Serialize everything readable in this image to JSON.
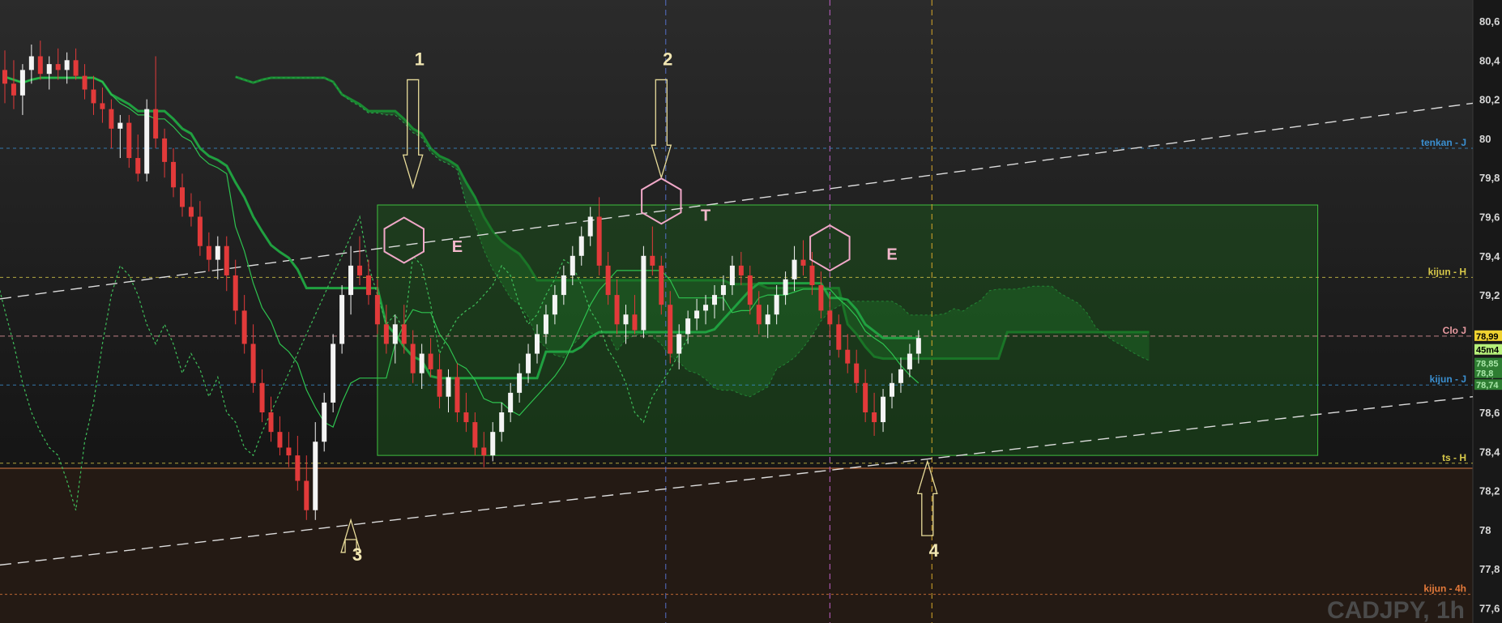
{
  "chart_data": {
    "type": "candlestick",
    "symbol_label": "CADJPY, 1h",
    "ylim": [
      77.55,
      80.7
    ],
    "y_ticks": [
      "80,6",
      "80,4",
      "80,2",
      "80",
      "79,8",
      "79,6",
      "79,4",
      "79,2",
      "79",
      "78,8",
      "78,6",
      "78,4",
      "78,2",
      "78",
      "77,8",
      "77,6"
    ],
    "y_tick_values": [
      80.6,
      80.4,
      80.2,
      80.0,
      79.8,
      79.6,
      79.4,
      79.2,
      79.0,
      78.8,
      78.6,
      78.4,
      78.2,
      78.0,
      77.8,
      77.6
    ],
    "levels": [
      {
        "label": "tenkan - J",
        "value": 79.95,
        "color": "#3a8fd0",
        "dash": "4,4"
      },
      {
        "label": "kijun - H",
        "value": 79.29,
        "color": "#d8c94a",
        "dash": "4,4"
      },
      {
        "label": "Clo J",
        "value": 78.99,
        "color": "#e89aa0",
        "dash": "6,4"
      },
      {
        "label": "kijun - J",
        "value": 78.74,
        "color": "#3a8fd0",
        "dash": "4,4"
      },
      {
        "label": "ts - H",
        "value": 78.34,
        "color": "#d8c94a",
        "dash": "4,4"
      },
      {
        "label": "kijun - 4h",
        "value": 77.67,
        "color": "#e57a3a",
        "dash": "3,3"
      }
    ],
    "price_badges": [
      {
        "label": "78,99",
        "value": 78.99,
        "bg": "#f0d230",
        "fg": "#000000"
      },
      {
        "label": "45m4",
        "value": 78.92,
        "bg": "#b6f07a",
        "fg": "#000000"
      },
      {
        "label": "78,85",
        "value": 78.85,
        "bg": "#2e7d32",
        "fg": "#a8e6a8"
      },
      {
        "label": "78,8",
        "value": 78.8,
        "bg": "#2e7d32",
        "fg": "#a8e6a8"
      },
      {
        "label": "78,74",
        "value": 78.74,
        "bg": "#2e7d32",
        "fg": "#a8e6a8"
      }
    ],
    "annotations": {
      "arrows": [
        {
          "label": "1",
          "bar": 46,
          "dir": "down",
          "from": 80.3,
          "to": 79.75
        },
        {
          "label": "2",
          "bar": 74,
          "dir": "down",
          "from": 80.3,
          "to": 79.8
        },
        {
          "label": "3",
          "bar": 39,
          "dir": "up",
          "from": 77.95,
          "to": 78.05
        },
        {
          "label": "4",
          "bar": 104,
          "dir": "up",
          "from": 77.97,
          "to": 78.35
        }
      ],
      "pattern_letters": [
        {
          "label": "E",
          "bar": 51,
          "value": 79.42
        },
        {
          "label": "T",
          "bar": 79,
          "value": 79.58
        },
        {
          "label": "E",
          "bar": 100,
          "value": 79.38
        }
      ],
      "hexagons": [
        {
          "bar": 45,
          "value": 79.48
        },
        {
          "bar": 74,
          "value": 79.68
        },
        {
          "bar": 93,
          "value": 79.44
        }
      ],
      "range_box": {
        "from_bar": 42,
        "to_bar": 148,
        "high": 79.66,
        "low": 78.38
      }
    },
    "candles": [
      [
        80.35,
        80.45,
        80.18,
        80.28
      ],
      [
        80.28,
        80.4,
        80.15,
        80.22
      ],
      [
        80.22,
        80.38,
        80.12,
        80.35
      ],
      [
        80.35,
        80.48,
        80.28,
        80.42
      ],
      [
        80.42,
        80.5,
        80.3,
        80.33
      ],
      [
        80.33,
        80.42,
        80.25,
        80.38
      ],
      [
        80.38,
        80.46,
        80.3,
        80.35
      ],
      [
        80.35,
        80.44,
        80.28,
        80.4
      ],
      [
        80.4,
        80.46,
        80.3,
        80.32
      ],
      [
        80.32,
        80.38,
        80.2,
        80.25
      ],
      [
        80.25,
        80.32,
        80.12,
        80.18
      ],
      [
        80.18,
        80.26,
        80.08,
        80.15
      ],
      [
        80.15,
        80.2,
        79.95,
        80.05
      ],
      [
        80.05,
        80.12,
        79.9,
        80.08
      ],
      [
        80.08,
        80.12,
        79.85,
        79.9
      ],
      [
        79.9,
        80.02,
        79.78,
        79.82
      ],
      [
        79.82,
        80.2,
        79.78,
        80.15
      ],
      [
        80.15,
        80.42,
        79.95,
        80.0
      ],
      [
        80.0,
        80.05,
        79.8,
        79.88
      ],
      [
        79.88,
        79.95,
        79.7,
        79.75
      ],
      [
        79.75,
        79.82,
        79.6,
        79.65
      ],
      [
        79.65,
        79.72,
        79.55,
        79.6
      ],
      [
        79.6,
        79.68,
        79.4,
        79.45
      ],
      [
        79.45,
        79.52,
        79.32,
        79.38
      ],
      [
        79.38,
        79.5,
        79.28,
        79.45
      ],
      [
        79.45,
        79.5,
        79.22,
        79.3
      ],
      [
        79.3,
        79.38,
        79.05,
        79.12
      ],
      [
        79.12,
        79.2,
        78.9,
        78.95
      ],
      [
        78.95,
        79.05,
        78.7,
        78.75
      ],
      [
        78.75,
        78.82,
        78.55,
        78.6
      ],
      [
        78.6,
        78.68,
        78.45,
        78.5
      ],
      [
        78.5,
        78.58,
        78.38,
        78.42
      ],
      [
        78.42,
        78.5,
        78.32,
        78.38
      ],
      [
        78.38,
        78.48,
        78.2,
        78.25
      ],
      [
        78.25,
        78.38,
        78.05,
        78.1
      ],
      [
        78.1,
        78.55,
        78.05,
        78.45
      ],
      [
        78.45,
        78.7,
        78.4,
        78.65
      ],
      [
        78.65,
        79.0,
        78.6,
        78.95
      ],
      [
        78.95,
        79.25,
        78.9,
        79.2
      ],
      [
        79.2,
        79.45,
        79.1,
        79.35
      ],
      [
        79.35,
        79.5,
        79.25,
        79.3
      ],
      [
        79.3,
        79.38,
        79.15,
        79.2
      ],
      [
        79.2,
        79.28,
        79.0,
        79.05
      ],
      [
        79.05,
        79.15,
        78.9,
        78.95
      ],
      [
        78.95,
        79.1,
        78.85,
        79.05
      ],
      [
        79.05,
        79.15,
        78.9,
        78.95
      ],
      [
        78.95,
        79.02,
        78.75,
        78.8
      ],
      [
        78.8,
        78.95,
        78.72,
        78.9
      ],
      [
        78.9,
        78.98,
        78.78,
        78.82
      ],
      [
        78.82,
        78.9,
        78.62,
        78.68
      ],
      [
        78.68,
        78.82,
        78.6,
        78.78
      ],
      [
        78.78,
        78.85,
        78.55,
        78.6
      ],
      [
        78.6,
        78.7,
        78.5,
        78.55
      ],
      [
        78.55,
        78.6,
        78.38,
        78.42
      ],
      [
        78.42,
        78.5,
        78.32,
        78.38
      ],
      [
        78.38,
        78.55,
        78.35,
        78.5
      ],
      [
        78.5,
        78.65,
        78.45,
        78.6
      ],
      [
        78.6,
        78.75,
        78.55,
        78.7
      ],
      [
        78.7,
        78.85,
        78.65,
        78.8
      ],
      [
        78.8,
        78.95,
        78.75,
        78.9
      ],
      [
        78.9,
        79.05,
        78.85,
        79.0
      ],
      [
        79.0,
        79.15,
        78.95,
        79.1
      ],
      [
        79.1,
        79.25,
        79.05,
        79.2
      ],
      [
        79.2,
        79.35,
        79.15,
        79.3
      ],
      [
        79.3,
        79.45,
        79.25,
        79.4
      ],
      [
        79.4,
        79.55,
        79.35,
        79.5
      ],
      [
        79.5,
        79.65,
        79.45,
        79.6
      ],
      [
        79.6,
        79.7,
        79.3,
        79.35
      ],
      [
        79.35,
        79.42,
        79.15,
        79.2
      ],
      [
        79.2,
        79.28,
        79.0,
        79.05
      ],
      [
        79.05,
        79.15,
        78.95,
        79.1
      ],
      [
        79.1,
        79.2,
        79.0,
        79.02
      ],
      [
        79.02,
        79.45,
        78.98,
        79.4
      ],
      [
        79.4,
        79.55,
        79.3,
        79.35
      ],
      [
        79.35,
        79.4,
        79.1,
        79.15
      ],
      [
        79.15,
        79.22,
        78.85,
        78.9
      ],
      [
        78.9,
        79.05,
        78.82,
        79.0
      ],
      [
        79.0,
        79.12,
        78.95,
        79.08
      ],
      [
        79.08,
        79.18,
        79.02,
        79.12
      ],
      [
        79.12,
        79.2,
        79.05,
        79.15
      ],
      [
        79.15,
        79.25,
        79.08,
        79.2
      ],
      [
        79.2,
        79.3,
        79.12,
        79.25
      ],
      [
        79.25,
        79.4,
        79.2,
        79.35
      ],
      [
        79.35,
        79.42,
        79.25,
        79.3
      ],
      [
        79.3,
        79.35,
        79.1,
        79.15
      ],
      [
        79.15,
        79.22,
        79.0,
        79.05
      ],
      [
        79.05,
        79.15,
        78.98,
        79.1
      ],
      [
        79.1,
        79.25,
        79.05,
        79.2
      ],
      [
        79.2,
        79.32,
        79.15,
        79.28
      ],
      [
        79.28,
        79.45,
        79.22,
        79.38
      ],
      [
        79.38,
        79.48,
        79.3,
        79.35
      ],
      [
        79.35,
        79.42,
        79.2,
        79.25
      ],
      [
        79.25,
        79.32,
        79.08,
        79.12
      ],
      [
        79.12,
        79.2,
        78.98,
        79.05
      ],
      [
        79.05,
        79.1,
        78.88,
        78.92
      ],
      [
        78.92,
        79.0,
        78.8,
        78.85
      ],
      [
        78.85,
        78.92,
        78.7,
        78.75
      ],
      [
        78.75,
        78.82,
        78.55,
        78.6
      ],
      [
        78.6,
        78.7,
        78.48,
        78.55
      ],
      [
        78.55,
        78.72,
        78.5,
        78.68
      ],
      [
        78.68,
        78.8,
        78.62,
        78.75
      ],
      [
        78.75,
        78.88,
        78.7,
        78.82
      ],
      [
        78.82,
        78.95,
        78.78,
        78.9
      ],
      [
        78.9,
        79.02,
        78.85,
        78.98
      ]
    ]
  }
}
